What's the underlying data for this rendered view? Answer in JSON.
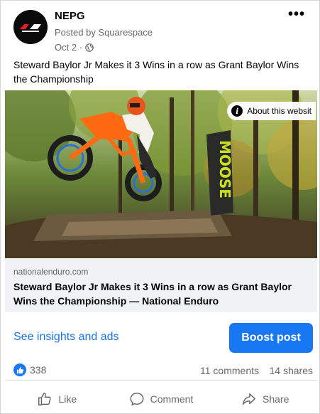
{
  "post": {
    "page_name": "NEPG",
    "posted_by": "Posted by Squarespace",
    "date": "Oct 2 ·",
    "text": "Steward Baylor Jr Makes it 3 Wins in a row as Grant Baylor Wins the Championship",
    "more_label": "•••"
  },
  "image": {
    "about_label": "About this websit",
    "banner_text": "MOOSE"
  },
  "link": {
    "domain": "nationalenduro.com",
    "title": "Steward Baylor Jr Makes it 3 Wins in a row as Grant Baylor Wins the Championship — National Enduro"
  },
  "insights": {
    "link_label": "See insights and ads",
    "boost_label": "Boost post"
  },
  "stats": {
    "reactions": "338",
    "comments": "11 comments",
    "shares": "14 shares"
  },
  "actions": {
    "like": "Like",
    "comment": "Comment",
    "share": "Share"
  },
  "colors": {
    "accent": "#1877f2",
    "link": "#1b74e4",
    "secondary_text": "#65676b"
  }
}
